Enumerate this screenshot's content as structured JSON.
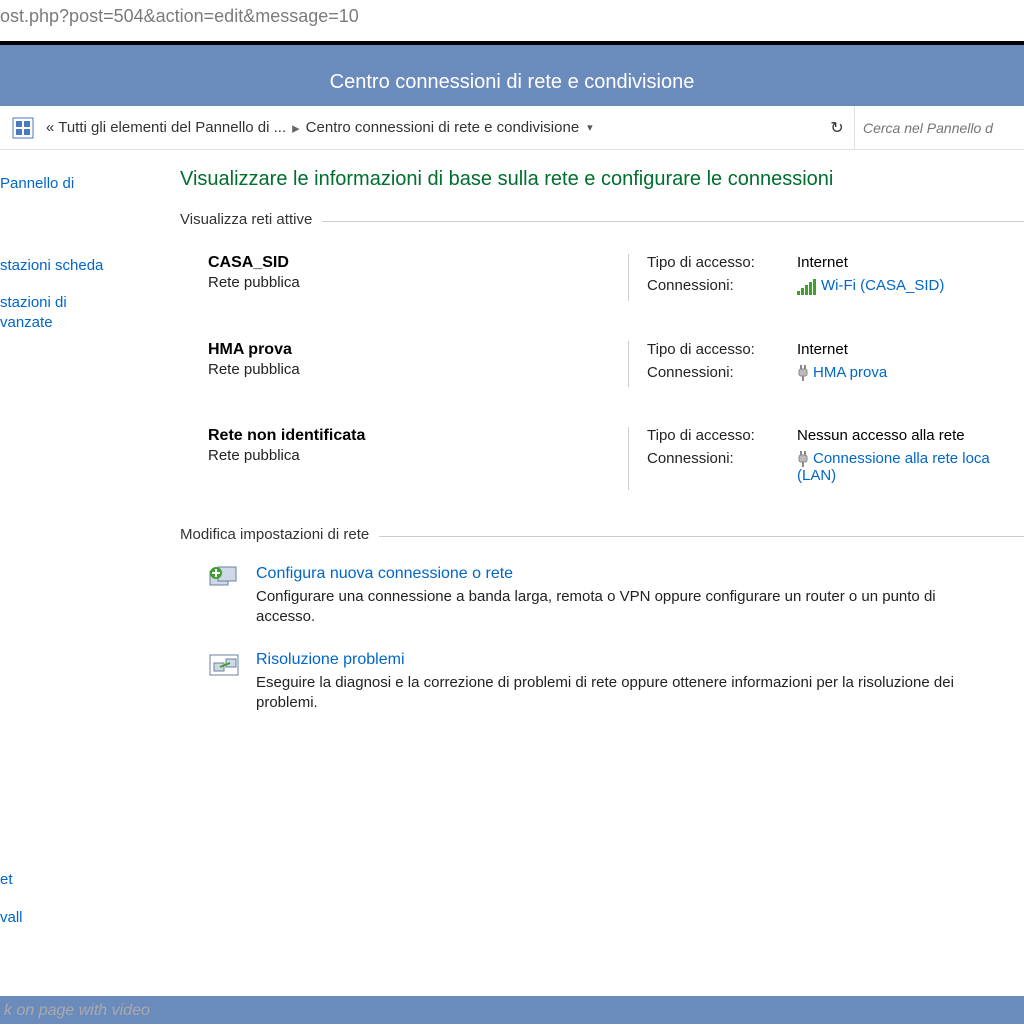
{
  "url_fragment": "ost.php?post=504&action=edit&message=10",
  "window_title": "Centro connessioni di rete e condivisione",
  "breadcrumb": {
    "root": "« Tutti gli elementi del Pannello di ...",
    "current": "Centro connessioni di rete e condivisione"
  },
  "search_placeholder": "Cerca nel Pannello d",
  "sidebar": {
    "items": [
      "Pannello di",
      "stazioni scheda",
      "stazioni di\nvanzate"
    ],
    "bottom_items": [
      "et",
      "vall"
    ]
  },
  "main": {
    "heading": "Visualizzare le informazioni di base sulla rete e configurare le connessioni",
    "active_networks_label": "Visualizza reti attive",
    "networks": [
      {
        "name": "CASA_SID",
        "type": "Rete pubblica",
        "access_label": "Tipo di accesso:",
        "access_value": "Internet",
        "conn_label": "Connessioni:",
        "conn_kind": "wifi",
        "conn_text": "Wi-Fi (CASA_SID)"
      },
      {
        "name": "HMA prova",
        "type": "Rete pubblica",
        "access_label": "Tipo di accesso:",
        "access_value": "Internet",
        "conn_label": "Connessioni:",
        "conn_kind": "plug",
        "conn_text": "HMA prova"
      },
      {
        "name": "Rete non identificata",
        "type": "Rete pubblica",
        "access_label": "Tipo di accesso:",
        "access_value": "Nessun accesso alla rete",
        "conn_label": "Connessioni:",
        "conn_kind": "plug",
        "conn_text": "Connessione alla rete loca (LAN)"
      }
    ],
    "settings_label": "Modifica impostazioni di rete",
    "settings": [
      {
        "title": "Configura nuova connessione o rete",
        "desc": "Configurare una connessione a banda larga, remota o VPN oppure configurare un router o un punto di accesso.",
        "icon": "network-add"
      },
      {
        "title": "Risoluzione problemi",
        "desc": "Eseguire la diagnosi e la correzione di problemi di rete oppure ottenere informazioni per la risoluzione dei problemi.",
        "icon": "troubleshoot"
      }
    ]
  },
  "bottom_text": "k on page with video"
}
